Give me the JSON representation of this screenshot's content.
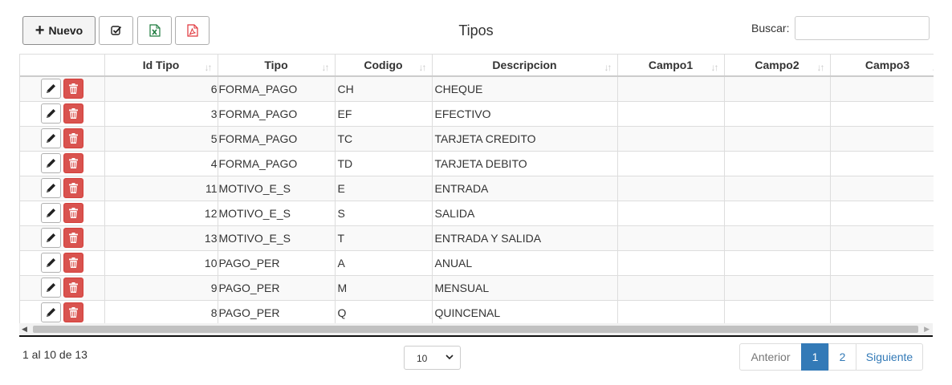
{
  "toolbar": {
    "new_label": "Nuevo",
    "title": "Tipos",
    "search_label": "Buscar:",
    "search_value": ""
  },
  "table": {
    "columns": [
      "",
      "Id Tipo",
      "Tipo",
      "Codigo",
      "Descripcion",
      "Campo1",
      "Campo2",
      "Campo3"
    ],
    "rows": [
      {
        "id": "6",
        "tipo": "FORMA_PAGO",
        "codigo": "CH",
        "descripcion": "CHEQUE",
        "campo1": "",
        "campo2": "",
        "campo3": ""
      },
      {
        "id": "3",
        "tipo": "FORMA_PAGO",
        "codigo": "EF",
        "descripcion": "EFECTIVO",
        "campo1": "",
        "campo2": "",
        "campo3": ""
      },
      {
        "id": "5",
        "tipo": "FORMA_PAGO",
        "codigo": "TC",
        "descripcion": "TARJETA CREDITO",
        "campo1": "",
        "campo2": "",
        "campo3": ""
      },
      {
        "id": "4",
        "tipo": "FORMA_PAGO",
        "codigo": "TD",
        "descripcion": "TARJETA DEBITO",
        "campo1": "",
        "campo2": "",
        "campo3": ""
      },
      {
        "id": "11",
        "tipo": "MOTIVO_E_S",
        "codigo": "E",
        "descripcion": "ENTRADA",
        "campo1": "",
        "campo2": "",
        "campo3": ""
      },
      {
        "id": "12",
        "tipo": "MOTIVO_E_S",
        "codigo": "S",
        "descripcion": "SALIDA",
        "campo1": "",
        "campo2": "",
        "campo3": ""
      },
      {
        "id": "13",
        "tipo": "MOTIVO_E_S",
        "codigo": "T",
        "descripcion": "ENTRADA Y SALIDA",
        "campo1": "",
        "campo2": "",
        "campo3": ""
      },
      {
        "id": "10",
        "tipo": "PAGO_PER",
        "codigo": "A",
        "descripcion": "ANUAL",
        "campo1": "",
        "campo2": "",
        "campo3": ""
      },
      {
        "id": "9",
        "tipo": "PAGO_PER",
        "codigo": "M",
        "descripcion": "MENSUAL",
        "campo1": "",
        "campo2": "",
        "campo3": ""
      },
      {
        "id": "8",
        "tipo": "PAGO_PER",
        "codigo": "Q",
        "descripcion": "QUINCENAL",
        "campo1": "",
        "campo2": "",
        "campo3": ""
      }
    ]
  },
  "footer": {
    "info": "1 al 10 de 13",
    "page_size": "10",
    "prev_label": "Anterior",
    "pages": [
      "1",
      "2"
    ],
    "current_page": "1",
    "next_label": "Siguiente"
  },
  "icons": {
    "new": "plus-icon",
    "select": "check-square-icon",
    "excel": "excel-file-icon",
    "pdf": "pdf-file-icon",
    "edit": "pencil-icon",
    "delete": "trash-icon",
    "sort": "sort-icon"
  },
  "colors": {
    "primary": "#337ab7",
    "danger": "#d9534f",
    "excel": "#1d7a3e",
    "pdf": "#e0343a"
  }
}
